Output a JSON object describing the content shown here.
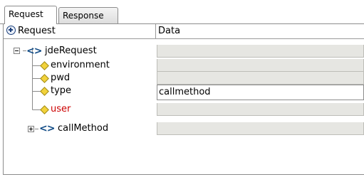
{
  "tabs": [
    {
      "label": "Request",
      "selected": true
    },
    {
      "label": "Response",
      "selected": false
    }
  ],
  "table": {
    "columns": [
      "Request",
      "Data"
    ],
    "rows": [
      {
        "label": "jdeRequest",
        "kind": "element",
        "expander": "expanded",
        "data": ""
      },
      {
        "label": "environment",
        "kind": "attribute",
        "data": ""
      },
      {
        "label": "pwd",
        "kind": "attribute",
        "data": ""
      },
      {
        "label": "type",
        "kind": "attribute",
        "data": "callmethod",
        "editable": true
      },
      {
        "label": "user",
        "kind": "attribute",
        "data": "",
        "required": true
      },
      {
        "label": "callMethod",
        "kind": "element",
        "expander": "collapsed",
        "data": ""
      }
    ]
  },
  "colors": {
    "required_text": "#cc0000",
    "element_icon": "#0f4a85",
    "attribute_icon": "#f2d23a",
    "readonly_cell": "#e6e6e2"
  },
  "icons": {
    "header": "add-circle-icon",
    "element": "xml-element-icon",
    "attribute": "attribute-diamond-icon"
  }
}
